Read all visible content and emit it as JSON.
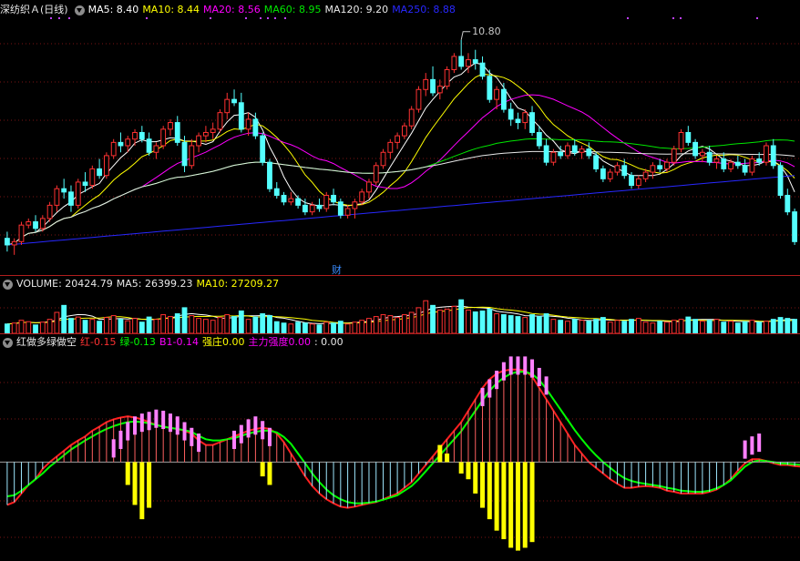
{
  "main_legend": {
    "stock": "深纺织Ａ(日线)",
    "ma5": "MA5: 8.40",
    "ma10": "MA10: 8.44",
    "ma20": "MA20: 8.56",
    "ma60": "MA60: 8.95",
    "ma120": "MA120: 9.20",
    "ma250": "MA250: 8.88"
  },
  "peak_label": "10.80",
  "event_marker": "财",
  "volume_legend": {
    "volume": "VOLUME: 20424.79",
    "ma5": "MA5: 26399.23",
    "ma10": "MA10: 27209.27"
  },
  "indicator_legend": {
    "name": "红做多绿做空",
    "hong_label": "红",
    "hong_value": "-0.15",
    "lv_label": "绿",
    "lv_value": "-0.13",
    "b1_label": "B1",
    "b1_value": "-0.14",
    "qiangzhuang_label": "强庄",
    "qiangzhuang_value": "0.00",
    "zhuli_label": "主力强度",
    "zhuli_value": "0.00",
    "extra_value": ": 0.00"
  },
  "colors": {
    "up": "#ff3232",
    "down": "#54ffff",
    "ma5": "#ffffff",
    "ma10": "#ffff00",
    "ma20": "#ff00ff",
    "ma60": "#00e600",
    "ma120": "#e8e8e8",
    "ma250": "#2828ff",
    "pink": "#ff80ff",
    "yellow": "#ffff00",
    "green": "#00ff00"
  },
  "chart_data": {
    "type": "candlestick",
    "price_ylim": [
      7.3,
      11.1
    ],
    "candles": [
      [
        7.8,
        7.9,
        7.6,
        7.7
      ],
      [
        7.7,
        7.8,
        7.55,
        7.75
      ],
      [
        7.75,
        8.05,
        7.7,
        8.0
      ],
      [
        8.0,
        8.1,
        7.95,
        8.05
      ],
      [
        8.05,
        8.15,
        7.9,
        7.95
      ],
      [
        7.95,
        8.15,
        7.9,
        8.1
      ],
      [
        8.1,
        8.35,
        8.05,
        8.3
      ],
      [
        8.3,
        8.6,
        8.2,
        8.55
      ],
      [
        8.55,
        8.7,
        8.4,
        8.5
      ],
      [
        8.5,
        8.6,
        8.2,
        8.3
      ],
      [
        8.3,
        8.7,
        8.25,
        8.65
      ],
      [
        8.65,
        8.8,
        8.5,
        8.6
      ],
      [
        8.6,
        8.9,
        8.55,
        8.85
      ],
      [
        8.85,
        9.0,
        8.7,
        8.75
      ],
      [
        8.75,
        9.1,
        8.7,
        9.05
      ],
      [
        9.05,
        9.3,
        9.0,
        9.25
      ],
      [
        9.25,
        9.4,
        9.1,
        9.2
      ],
      [
        9.2,
        9.35,
        9.1,
        9.3
      ],
      [
        9.3,
        9.45,
        9.2,
        9.4
      ],
      [
        9.4,
        9.5,
        9.25,
        9.3
      ],
      [
        9.3,
        9.4,
        9.05,
        9.1
      ],
      [
        9.1,
        9.25,
        9.0,
        9.2
      ],
      [
        9.2,
        9.5,
        9.15,
        9.45
      ],
      [
        9.45,
        9.6,
        9.35,
        9.55
      ],
      [
        9.55,
        9.65,
        9.2,
        9.25
      ],
      [
        9.25,
        9.35,
        8.8,
        8.9
      ],
      [
        8.9,
        9.3,
        8.85,
        9.2
      ],
      [
        9.2,
        9.4,
        9.1,
        9.35
      ],
      [
        9.35,
        9.5,
        9.25,
        9.4
      ],
      [
        9.4,
        9.55,
        9.3,
        9.45
      ],
      [
        9.45,
        9.75,
        9.4,
        9.7
      ],
      [
        9.7,
        10.0,
        9.6,
        9.9
      ],
      [
        9.9,
        10.05,
        9.8,
        9.85
      ],
      [
        9.85,
        10.0,
        9.4,
        9.45
      ],
      [
        9.45,
        9.7,
        9.35,
        9.6
      ],
      [
        9.6,
        9.7,
        9.3,
        9.35
      ],
      [
        9.35,
        9.4,
        8.9,
        8.95
      ],
      [
        8.95,
        9.0,
        8.5,
        8.55
      ],
      [
        8.55,
        8.65,
        8.4,
        8.45
      ],
      [
        8.45,
        8.5,
        8.3,
        8.35
      ],
      [
        8.35,
        8.5,
        8.3,
        8.4
      ],
      [
        8.4,
        8.45,
        8.25,
        8.3
      ],
      [
        8.3,
        8.4,
        8.15,
        8.2
      ],
      [
        8.2,
        8.35,
        8.15,
        8.3
      ],
      [
        8.3,
        8.4,
        8.2,
        8.25
      ],
      [
        8.25,
        8.5,
        8.2,
        8.45
      ],
      [
        8.45,
        8.55,
        8.3,
        8.35
      ],
      [
        8.35,
        8.4,
        8.1,
        8.15
      ],
      [
        8.15,
        8.3,
        8.1,
        8.25
      ],
      [
        8.25,
        8.4,
        8.1,
        8.35
      ],
      [
        8.35,
        8.55,
        8.3,
        8.5
      ],
      [
        8.5,
        8.7,
        8.4,
        8.65
      ],
      [
        8.65,
        8.95,
        8.6,
        8.9
      ],
      [
        8.9,
        9.15,
        8.85,
        9.1
      ],
      [
        9.1,
        9.3,
        9.0,
        9.25
      ],
      [
        9.25,
        9.4,
        9.15,
        9.35
      ],
      [
        9.35,
        9.55,
        9.3,
        9.5
      ],
      [
        9.5,
        9.8,
        9.45,
        9.75
      ],
      [
        9.75,
        10.1,
        9.7,
        10.05
      ],
      [
        10.05,
        10.3,
        9.95,
        10.2
      ],
      [
        10.2,
        10.4,
        9.95,
        10.0
      ],
      [
        10.0,
        10.2,
        9.9,
        10.1
      ],
      [
        10.1,
        10.4,
        10.05,
        10.35
      ],
      [
        10.35,
        10.6,
        10.3,
        10.55
      ],
      [
        10.55,
        10.8,
        10.35,
        10.4
      ],
      [
        10.4,
        10.6,
        10.3,
        10.5
      ],
      [
        10.5,
        10.65,
        10.35,
        10.45
      ],
      [
        10.45,
        10.55,
        10.2,
        10.25
      ],
      [
        10.25,
        10.35,
        9.85,
        9.9
      ],
      [
        9.9,
        10.1,
        9.75,
        10.05
      ],
      [
        10.05,
        10.15,
        9.7,
        9.75
      ],
      [
        9.75,
        9.85,
        9.5,
        9.6
      ],
      [
        9.6,
        9.7,
        9.45,
        9.55
      ],
      [
        9.55,
        9.75,
        9.45,
        9.7
      ],
      [
        9.7,
        9.8,
        9.35,
        9.4
      ],
      [
        9.4,
        9.5,
        9.15,
        9.2
      ],
      [
        9.2,
        9.3,
        8.9,
        8.95
      ],
      [
        8.95,
        9.15,
        8.9,
        9.1
      ],
      [
        9.1,
        9.2,
        9.0,
        9.05
      ],
      [
        9.05,
        9.25,
        9.0,
        9.2
      ],
      [
        9.2,
        9.3,
        9.05,
        9.1
      ],
      [
        9.1,
        9.2,
        9.0,
        9.15
      ],
      [
        9.15,
        9.25,
        9.0,
        9.05
      ],
      [
        9.05,
        9.1,
        8.8,
        8.85
      ],
      [
        8.85,
        8.9,
        8.65,
        8.7
      ],
      [
        8.7,
        8.85,
        8.65,
        8.8
      ],
      [
        8.8,
        8.95,
        8.75,
        8.9
      ],
      [
        8.9,
        9.0,
        8.7,
        8.75
      ],
      [
        8.75,
        8.8,
        8.55,
        8.6
      ],
      [
        8.6,
        8.75,
        8.55,
        8.7
      ],
      [
        8.7,
        8.85,
        8.65,
        8.8
      ],
      [
        8.8,
        8.95,
        8.7,
        8.9
      ],
      [
        8.9,
        9.0,
        8.8,
        8.85
      ],
      [
        8.85,
        9.0,
        8.8,
        8.95
      ],
      [
        8.95,
        9.2,
        8.9,
        9.15
      ],
      [
        9.15,
        9.45,
        9.1,
        9.4
      ],
      [
        9.4,
        9.5,
        9.2,
        9.25
      ],
      [
        9.25,
        9.3,
        9.0,
        9.05
      ],
      [
        9.05,
        9.15,
        8.95,
        9.1
      ],
      [
        9.1,
        9.2,
        8.9,
        8.95
      ],
      [
        8.95,
        9.05,
        8.85,
        9.0
      ],
      [
        9.0,
        9.1,
        8.8,
        8.85
      ],
      [
        8.85,
        9.0,
        8.8,
        8.95
      ],
      [
        8.95,
        9.05,
        8.85,
        8.9
      ],
      [
        8.9,
        9.0,
        8.75,
        8.8
      ],
      [
        8.8,
        9.05,
        8.75,
        9.0
      ],
      [
        9.0,
        9.1,
        8.9,
        8.95
      ],
      [
        8.95,
        9.25,
        8.9,
        9.2
      ],
      [
        9.2,
        9.3,
        8.85,
        8.9
      ],
      [
        8.9,
        8.95,
        8.4,
        8.45
      ],
      [
        8.45,
        8.55,
        8.15,
        8.2
      ],
      [
        8.2,
        8.25,
        7.7,
        7.75
      ]
    ],
    "volume_ylim": [
      0,
      90000
    ],
    "volume": [
      20000,
      22000,
      28000,
      25000,
      18000,
      24000,
      30000,
      45000,
      60000,
      32000,
      35000,
      28000,
      30000,
      26000,
      34000,
      38000,
      30000,
      27000,
      32000,
      24000,
      35000,
      30000,
      40000,
      36000,
      42000,
      55000,
      38000,
      32000,
      30000,
      28000,
      34000,
      40000,
      36000,
      48000,
      30000,
      35000,
      42000,
      38000,
      25000,
      22000,
      20000,
      24000,
      22000,
      20000,
      18000,
      24000,
      22000,
      26000,
      20000,
      24000,
      28000,
      32000,
      36000,
      40000,
      38000,
      34000,
      40000,
      45000,
      55000,
      70000,
      60000,
      50000,
      52000,
      58000,
      72000,
      50000,
      46000,
      48000,
      52000,
      42000,
      40000,
      38000,
      36000,
      34000,
      40000,
      36000,
      42000,
      30000,
      28000,
      26000,
      30000,
      28000,
      26000,
      30000,
      34000,
      24000,
      28000,
      26000,
      30000,
      32000,
      24000,
      22000,
      26000,
      24000,
      28000,
      30000,
      35000,
      30000,
      26000,
      28000,
      30000,
      24000,
      26000,
      22000,
      25000,
      28000,
      24000,
      26000,
      30000,
      34000,
      32000,
      30000
    ],
    "indicator_ylim": [
      -1.7,
      2.0
    ],
    "hong": [
      -0.75,
      -0.7,
      -0.55,
      -0.4,
      -0.3,
      -0.12,
      0.0,
      0.1,
      0.2,
      0.3,
      0.38,
      0.45,
      0.55,
      0.62,
      0.7,
      0.75,
      0.78,
      0.8,
      0.78,
      0.75,
      0.7,
      0.65,
      0.62,
      0.6,
      0.58,
      0.55,
      0.5,
      0.38,
      0.3,
      0.3,
      0.35,
      0.4,
      0.45,
      0.5,
      0.55,
      0.58,
      0.6,
      0.58,
      0.5,
      0.35,
      0.15,
      -0.05,
      -0.25,
      -0.42,
      -0.55,
      -0.65,
      -0.72,
      -0.78,
      -0.8,
      -0.78,
      -0.75,
      -0.72,
      -0.7,
      -0.65,
      -0.6,
      -0.55,
      -0.45,
      -0.35,
      -0.2,
      -0.05,
      0.1,
      0.25,
      0.4,
      0.55,
      0.7,
      0.9,
      1.1,
      1.3,
      1.45,
      1.55,
      1.6,
      1.62,
      1.62,
      1.6,
      1.5,
      1.3,
      1.1,
      0.9,
      0.7,
      0.5,
      0.3,
      0.15,
      0.0,
      -0.1,
      -0.2,
      -0.3,
      -0.38,
      -0.45,
      -0.45,
      -0.43,
      -0.42,
      -0.43,
      -0.45,
      -0.5,
      -0.52,
      -0.55,
      -0.55,
      -0.55,
      -0.55,
      -0.52,
      -0.48,
      -0.4,
      -0.3,
      -0.15,
      -0.02,
      0.05,
      0.05,
      0.02,
      -0.02,
      -0.05,
      -0.05,
      -0.07,
      -0.08,
      -0.08,
      -0.1,
      -0.3,
      -0.5,
      -0.65
    ],
    "lv": [
      -0.6,
      -0.58,
      -0.5,
      -0.4,
      -0.3,
      -0.2,
      -0.08,
      0.02,
      0.12,
      0.22,
      0.3,
      0.38,
      0.45,
      0.52,
      0.58,
      0.63,
      0.67,
      0.7,
      0.71,
      0.7,
      0.68,
      0.65,
      0.62,
      0.6,
      0.58,
      0.56,
      0.53,
      0.46,
      0.4,
      0.38,
      0.38,
      0.4,
      0.42,
      0.46,
      0.5,
      0.53,
      0.55,
      0.55,
      0.52,
      0.44,
      0.32,
      0.15,
      -0.02,
      -0.2,
      -0.35,
      -0.48,
      -0.58,
      -0.65,
      -0.7,
      -0.72,
      -0.72,
      -0.71,
      -0.69,
      -0.66,
      -0.62,
      -0.58,
      -0.5,
      -0.42,
      -0.3,
      -0.16,
      -0.02,
      0.12,
      0.26,
      0.4,
      0.54,
      0.72,
      0.9,
      1.08,
      1.25,
      1.38,
      1.48,
      1.55,
      1.58,
      1.58,
      1.54,
      1.44,
      1.28,
      1.1,
      0.92,
      0.74,
      0.56,
      0.4,
      0.25,
      0.12,
      0.0,
      -0.1,
      -0.2,
      -0.28,
      -0.33,
      -0.36,
      -0.38,
      -0.4,
      -0.42,
      -0.45,
      -0.47,
      -0.5,
      -0.51,
      -0.52,
      -0.52,
      -0.5,
      -0.46,
      -0.4,
      -0.32,
      -0.2,
      -0.08,
      0.0,
      0.03,
      0.02,
      0.0,
      -0.02,
      -0.03,
      -0.04,
      -0.05,
      -0.05,
      -0.08,
      -0.2,
      -0.35,
      -0.5
    ],
    "pink_bars": [
      [
        15,
        0.4
      ],
      [
        16,
        0.55
      ],
      [
        17,
        0.7
      ],
      [
        18,
        0.8
      ],
      [
        19,
        0.85
      ],
      [
        20,
        0.88
      ],
      [
        21,
        0.92
      ],
      [
        22,
        0.9
      ],
      [
        23,
        0.85
      ],
      [
        24,
        0.8
      ],
      [
        25,
        0.7
      ],
      [
        26,
        0.6
      ],
      [
        27,
        0.5
      ],
      [
        32,
        0.55
      ],
      [
        33,
        0.65
      ],
      [
        34,
        0.75
      ],
      [
        35,
        0.8
      ],
      [
        36,
        0.72
      ],
      [
        37,
        0.6
      ],
      [
        67,
        1.3
      ],
      [
        68,
        1.45
      ],
      [
        69,
        1.6
      ],
      [
        70,
        1.75
      ],
      [
        71,
        1.85
      ],
      [
        72,
        1.85
      ],
      [
        73,
        1.85
      ],
      [
        74,
        1.8
      ],
      [
        75,
        1.65
      ],
      [
        76,
        1.5
      ],
      [
        104,
        0.38
      ],
      [
        105,
        0.45
      ],
      [
        106,
        0.5
      ]
    ],
    "yellow_bars": [
      [
        17,
        -0.4
      ],
      [
        18,
        -0.75
      ],
      [
        19,
        -1.0
      ],
      [
        20,
        -0.8
      ],
      [
        36,
        -0.25
      ],
      [
        37,
        -0.4
      ],
      [
        61,
        0.3
      ],
      [
        62,
        0.15
      ],
      [
        64,
        -0.2
      ],
      [
        65,
        -0.3
      ],
      [
        66,
        -0.55
      ],
      [
        67,
        -0.8
      ],
      [
        68,
        -1.0
      ],
      [
        69,
        -1.2
      ],
      [
        70,
        -1.35
      ],
      [
        71,
        -1.5
      ],
      [
        72,
        -1.55
      ],
      [
        73,
        -1.5
      ],
      [
        74,
        -1.4
      ]
    ]
  }
}
